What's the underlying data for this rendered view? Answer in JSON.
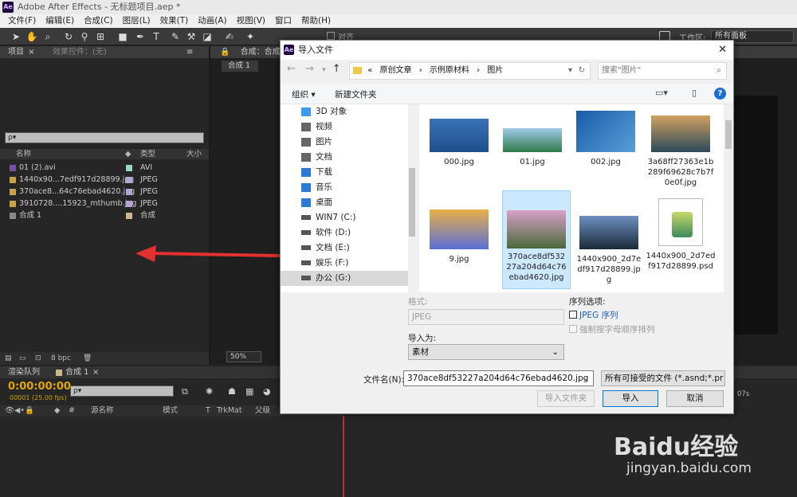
{
  "app": {
    "title": "Adobe After Effects - 无标题项目.aep *",
    "logo": "Ae"
  },
  "menu": [
    "文件(F)",
    "编辑(E)",
    "合成(C)",
    "图层(L)",
    "效果(T)",
    "动画(A)",
    "视图(V)",
    "窗口",
    "帮助(H)"
  ],
  "toolbar": {
    "snap_label": "对齐",
    "workspace_label": "工作区:",
    "workspace_value": "所有面板"
  },
  "project_panel": {
    "tab_project": "项目",
    "tab_effects": "效果控件：(无)",
    "search_placeholder": "ρ▾",
    "col_name": "名称",
    "col_type": "类型",
    "col_size": "大小",
    "items": [
      {
        "name": "01 (2).avi",
        "type": "AVI",
        "color": "#9ed3d0"
      },
      {
        "name": "1440x90...7edf917d28899.jpg",
        "type": "JPEG",
        "color": "#b3a6d6"
      },
      {
        "name": "370ace8...64c76ebad4620.jpg",
        "type": "JPEG",
        "color": "#b3a6d6"
      },
      {
        "name": "3910728....15923_mthumb.jpg",
        "type": "JPEG",
        "color": "#b3a6d6"
      },
      {
        "name": "合成 1",
        "type": "合成",
        "color": "#c9b98f"
      }
    ],
    "bpc": "8 bpc"
  },
  "comp_panel": {
    "tab": "合成：合成",
    "subtab": "合成 1",
    "zoom": "50%"
  },
  "timeline": {
    "tab_render": "渲染队列",
    "tab_comp": "合成 1",
    "timecode": "0:00:00:00",
    "frame_info": "00001 (25.00 fps)",
    "search_placeholder": "ρ▾",
    "col_source": "源名称",
    "col_mode": "模式",
    "col_t": "T",
    "col_trkmat": "TrkMat",
    "col_parent": "父级",
    "col_hash": "#",
    "ruler_mark": "07s"
  },
  "dialog": {
    "title": "导入文件",
    "breadcrumb": [
      "«",
      "原创文章",
      "示例原材料",
      "图片"
    ],
    "search_placeholder": "搜索\"图片\"",
    "organize": "组织 ▾",
    "new_folder": "新建文件夹",
    "tree": [
      {
        "label": "3D 对象",
        "icon": "cube-icon",
        "color": "#3d9be9"
      },
      {
        "label": "视频",
        "icon": "video-icon",
        "color": "#666"
      },
      {
        "label": "图片",
        "icon": "picture-icon",
        "color": "#666"
      },
      {
        "label": "文档",
        "icon": "document-icon",
        "color": "#666"
      },
      {
        "label": "下载",
        "icon": "download-icon",
        "color": "#2b7bd6"
      },
      {
        "label": "音乐",
        "icon": "music-icon",
        "color": "#2b7bd6"
      },
      {
        "label": "桌面",
        "icon": "desktop-icon",
        "color": "#2b7bd6"
      },
      {
        "label": "WIN7 (C:)",
        "icon": "drive-icon",
        "color": "#555"
      },
      {
        "label": "软件 (D:)",
        "icon": "drive-icon",
        "color": "#555"
      },
      {
        "label": "文档 (E:)",
        "icon": "drive-icon",
        "color": "#555"
      },
      {
        "label": "娱乐 (F:)",
        "icon": "drive-icon",
        "color": "#555"
      },
      {
        "label": "办公 (G:)",
        "icon": "drive-icon",
        "color": "#555"
      }
    ],
    "files": [
      {
        "name": "000.jpg"
      },
      {
        "name": "01.jpg"
      },
      {
        "name": "002.jpg"
      },
      {
        "name": "3a68ff27363e1b289f69628c7b7f0e0f.jpg"
      },
      {
        "name": "9.jpg"
      },
      {
        "name": "370ace8df53227a204d64c76ebad4620.jpg"
      },
      {
        "name": "1440x900_2d7edf917d28899.jpg"
      },
      {
        "name": "1440x900_2d7edf917d28899.psd"
      }
    ],
    "format_label": "格式:",
    "format_value": "JPEG",
    "import_as_label": "导入为:",
    "import_as_value": "素材",
    "sequence_label": "序列选项:",
    "sequence_checkbox": "JPEG 序列",
    "force_order": "强制按字母顺序排列",
    "filename_label": "文件名(N):",
    "filename_value": "370ace8df53227a204d64c76ebad4620.jpg",
    "filetype_value": "所有可接受的文件 (*.asnd;*.pr",
    "btn_import_folder": "导入文件夹",
    "btn_import": "导入",
    "btn_cancel": "取消",
    "close": "✕"
  },
  "watermark": {
    "brand": "Baidu经验",
    "url": "jingyan.baidu.com"
  }
}
